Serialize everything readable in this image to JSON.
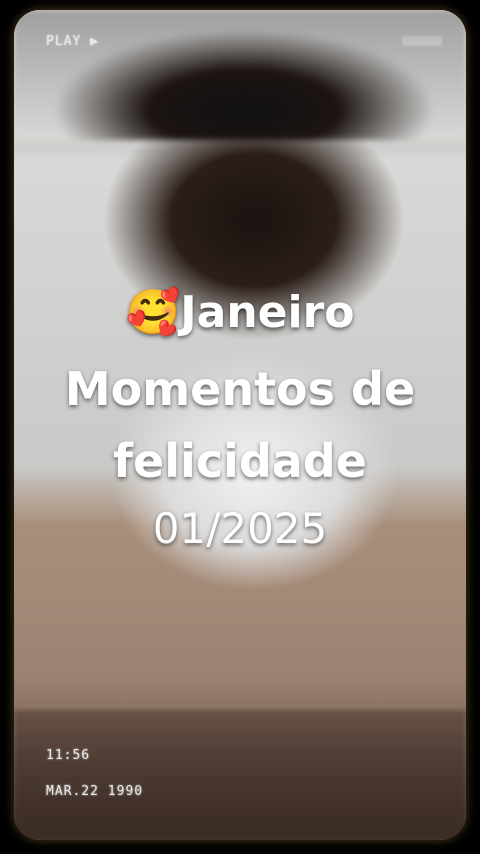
{
  "overlay": {
    "play_label": "PLAY ▶",
    "time": "11:56",
    "date": "MAR.22 1990"
  },
  "caption": {
    "line1": "🥰Janeiro",
    "line2": "Momentos de",
    "line3": "felicidade",
    "line4": "01/2025"
  }
}
